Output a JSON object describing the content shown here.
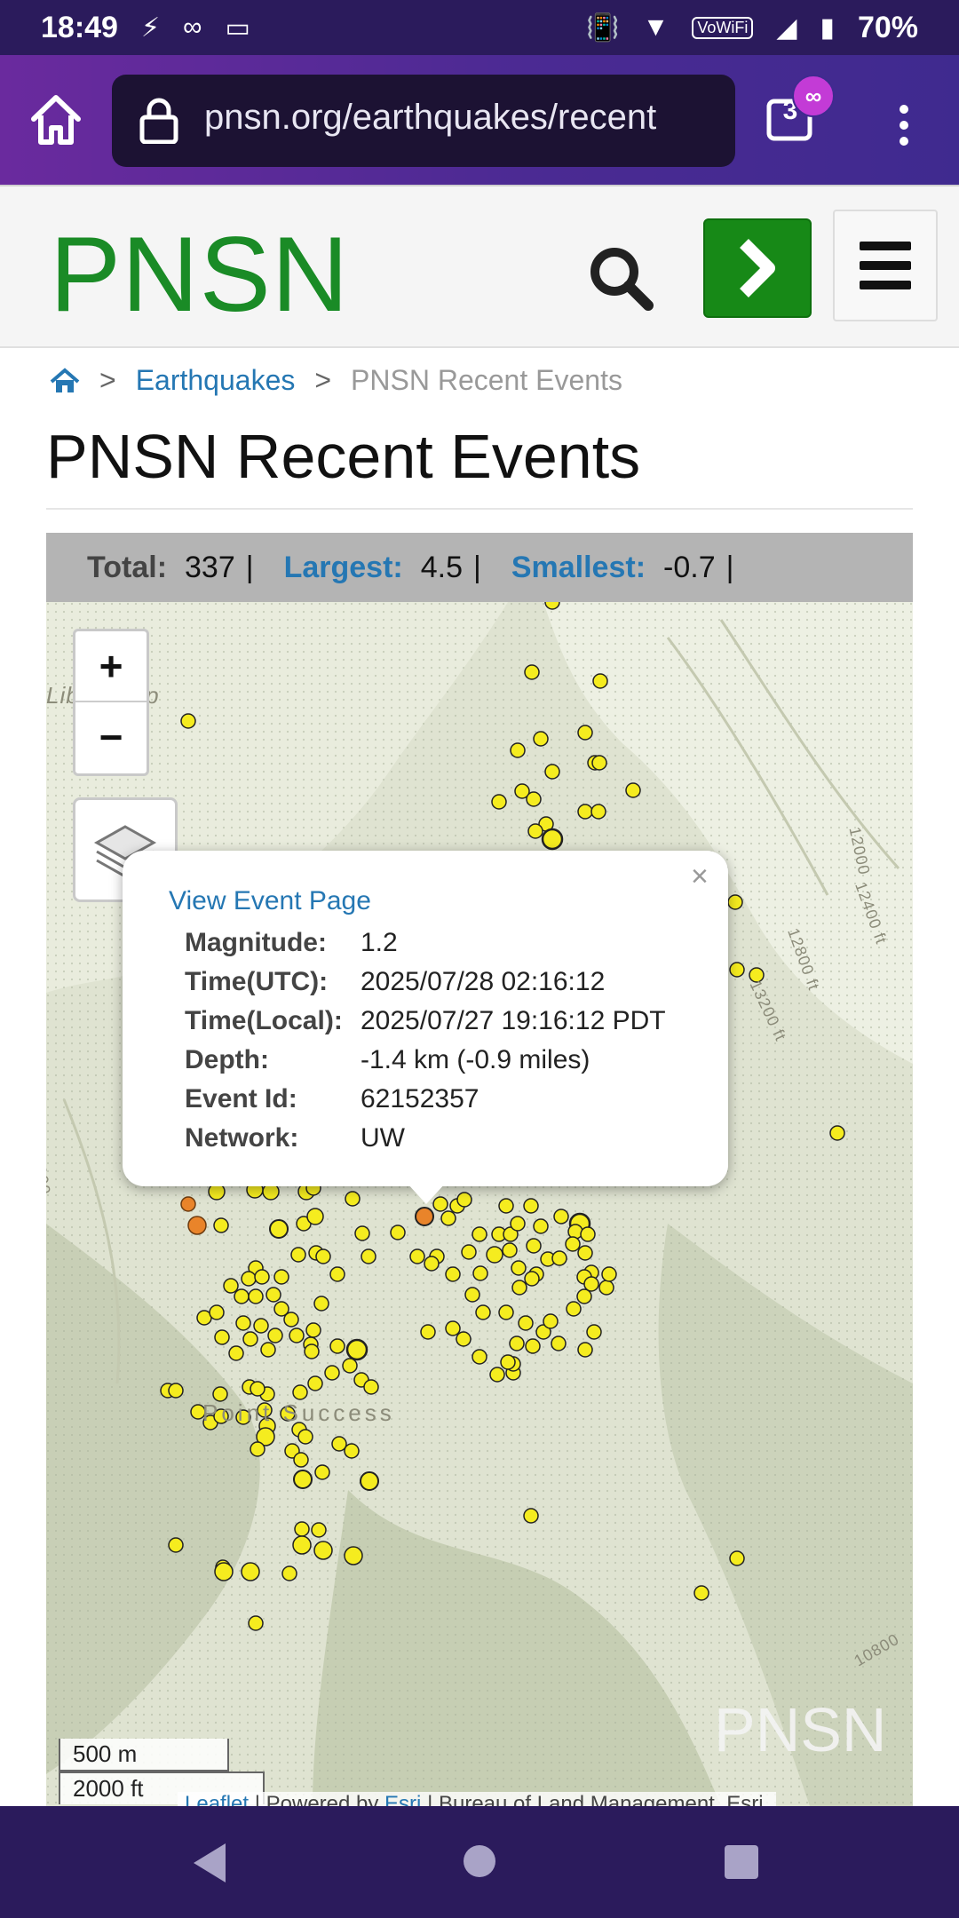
{
  "status_bar": {
    "time": "18:49",
    "battery": "70%",
    "wifi_label": "VoWiFi"
  },
  "browser": {
    "url": "pnsn.org/earthquakes/recent",
    "tab_count": "3",
    "incognito_badge": "∞"
  },
  "header": {
    "logo": "PNSN"
  },
  "breadcrumb": {
    "separator": ">",
    "items": [
      "Earthquakes",
      "PNSN Recent Events"
    ]
  },
  "page_title": "PNSN Recent Events",
  "stats": {
    "total_label": "Total:",
    "total_value": "337",
    "largest_label": "Largest:",
    "largest_value": "4.5",
    "smallest_label": "Smallest:",
    "smallest_value": "-0.7",
    "separator": "|"
  },
  "map": {
    "zoom_in": "+",
    "zoom_out": "−",
    "place_labels": [
      "Libby Gap",
      "Point Success"
    ],
    "contour_labels": [
      "12000",
      "12400 ft",
      "12800 ft",
      "13200 ft",
      "10800",
      "12000"
    ],
    "watermark": "PNSN",
    "scale_metric": "500 m",
    "scale_imperial": "2000 ft",
    "attribution_leaflet": "Leaflet",
    "attribution_powered": "| Powered by",
    "attribution_esri": "Esri",
    "attribution_rest": "| Bureau of Land Management, Esri,"
  },
  "popup": {
    "close": "×",
    "link": "View Event Page",
    "rows": [
      {
        "label": "Magnitude:",
        "value": "1.2"
      },
      {
        "label": "Time(UTC):",
        "value": "2025/07/28 02:16:12"
      },
      {
        "label": "Time(Local):",
        "value": "2025/07/27 19:16:12 PDT"
      },
      {
        "label": "Depth:",
        "value": "-1.4 km (-0.9 miles)"
      },
      {
        "label": "Event Id:",
        "value": "62152357"
      },
      {
        "label": "Network:",
        "value": "UW"
      }
    ]
  },
  "colors": {
    "brand_green": "#1a8b26",
    "link_blue": "#2577b3",
    "event_yellow": "#f5ec1f",
    "event_orange": "#e9842a",
    "status_bar": "#2b1b5c"
  }
}
